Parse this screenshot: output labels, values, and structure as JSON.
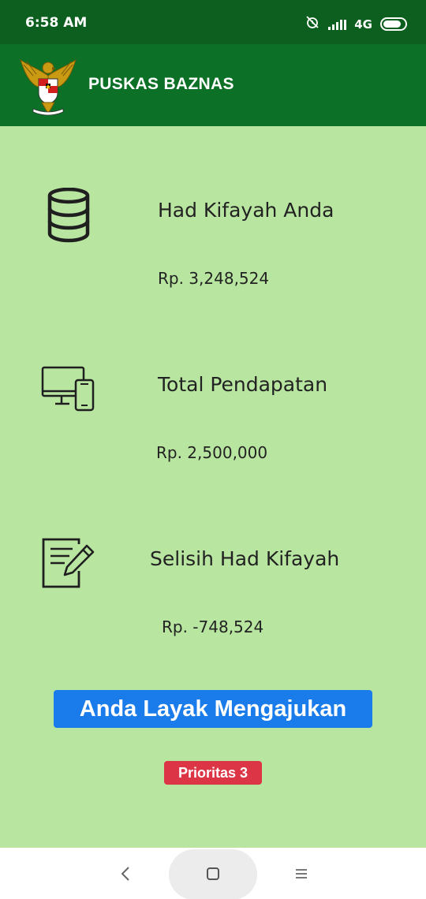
{
  "status_bar": {
    "time": "6:58 AM",
    "network": "4G",
    "icons": [
      "alarm-off-icon",
      "signal-icon",
      "battery-icon"
    ]
  },
  "app_bar": {
    "title": "PUSKAS BAZNAS",
    "logo": "garuda-emblem"
  },
  "rows": [
    {
      "icon": "database-icon",
      "title": "Had Kifayah Anda",
      "value": "Rp. 3,248,524"
    },
    {
      "icon": "devices-icon",
      "title": "Total Pendapatan",
      "value": "Rp. 2,500,000"
    },
    {
      "icon": "edit-document-icon",
      "title": "Selisih Had Kifayah",
      "value": "Rp. -748,524"
    }
  ],
  "result": {
    "label": "Anda Layak Mengajukan",
    "priority": "Prioritas 3"
  },
  "navigation": {
    "buttons": [
      "back-icon",
      "home-icon",
      "menu-icon"
    ]
  },
  "colors": {
    "status_bar": "#0c5f1e",
    "app_bar": "#0c7026",
    "background": "#b8e6a0",
    "cta": "#1a7bea",
    "badge": "#dc3545"
  }
}
